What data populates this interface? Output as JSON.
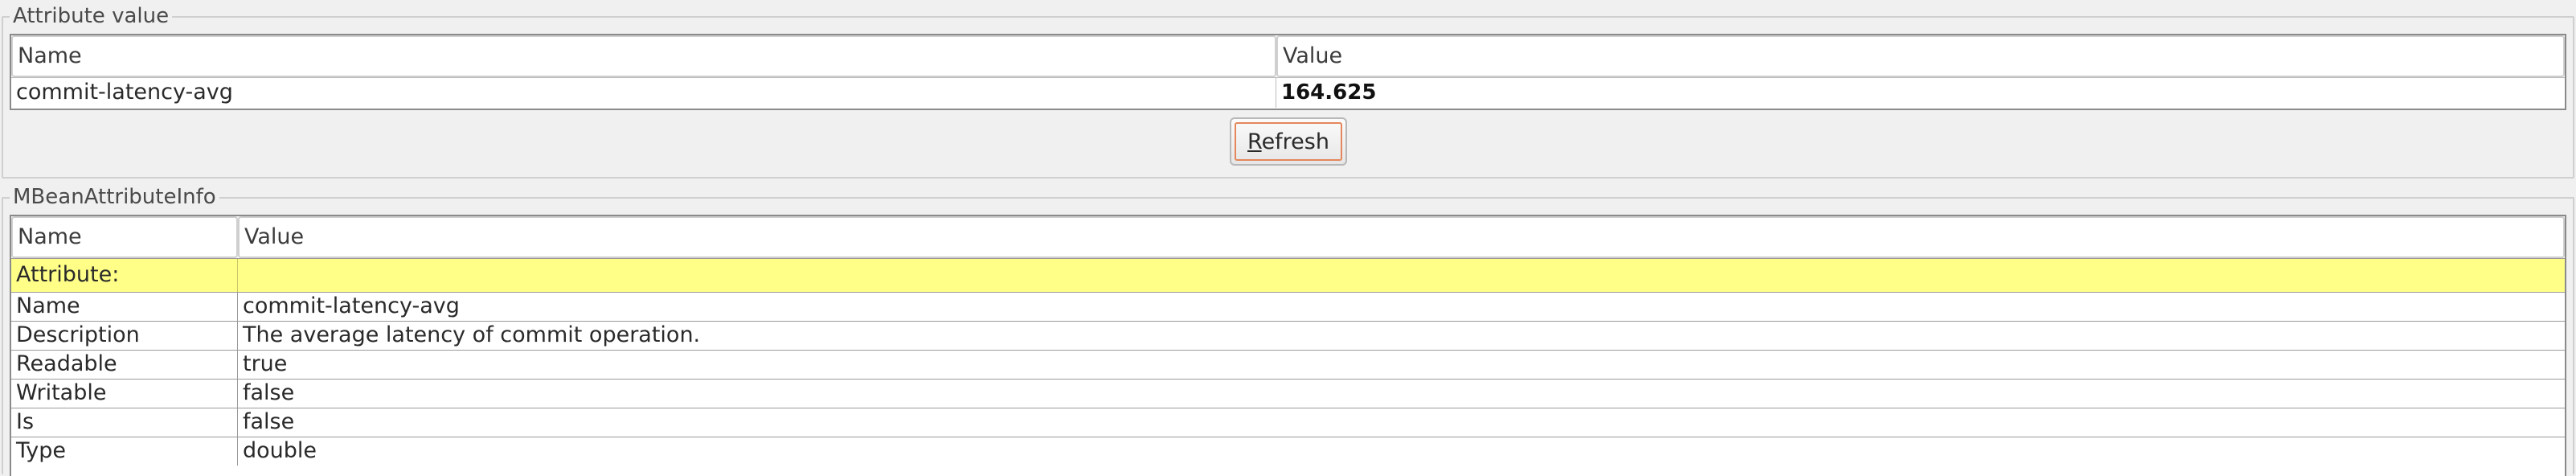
{
  "attribute_value_panel": {
    "title": "Attribute value",
    "columns": [
      "Name",
      "Value"
    ],
    "row": {
      "name": "commit-latency-avg",
      "value": "164.625"
    },
    "refresh_label_mnemonic": "R",
    "refresh_label_rest": "efresh"
  },
  "info_panel": {
    "title": "MBeanAttributeInfo",
    "columns": [
      "Name",
      "Value"
    ],
    "section_label": "Attribute:",
    "rows": [
      {
        "name": "Name",
        "value": "commit-latency-avg"
      },
      {
        "name": "Description",
        "value": "The average latency of commit operation."
      },
      {
        "name": "Readable",
        "value": "true"
      },
      {
        "name": "Writable",
        "value": "false"
      },
      {
        "name": "Is",
        "value": "false"
      },
      {
        "name": "Type",
        "value": "double"
      }
    ]
  },
  "colors": {
    "section_highlight": "#ffff88",
    "focus_ring": "#e4875c"
  }
}
